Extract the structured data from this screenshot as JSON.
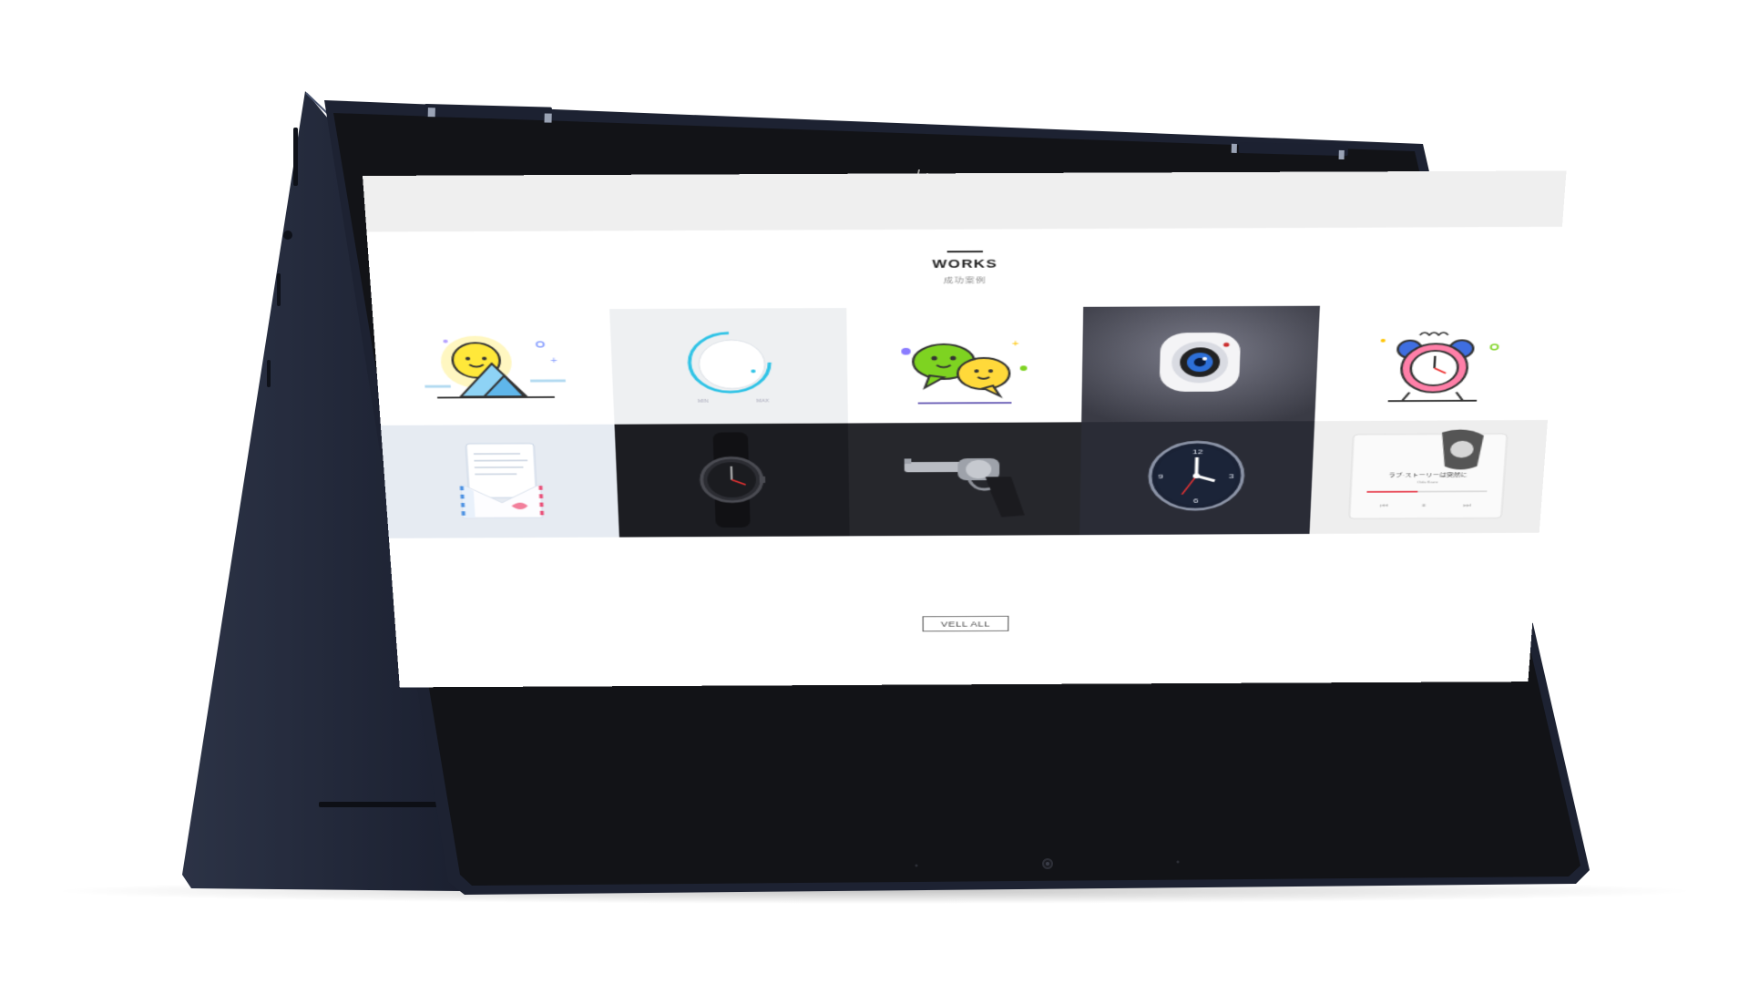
{
  "section": {
    "title": "WORKS",
    "subtitle": "成功案例"
  },
  "cta_label": "VELL ALL",
  "works": [
    {
      "icon": "sun-mountain-icon",
      "bg": "#ffffff"
    },
    {
      "icon": "dial-knob-icon",
      "bg": "#eef0f2"
    },
    {
      "icon": "chat-bubbles-icon",
      "bg": "#ffffff"
    },
    {
      "icon": "camera-app-icon",
      "bg": "#4a4b57"
    },
    {
      "icon": "alarm-clock-icon",
      "bg": "#ffffff"
    },
    {
      "icon": "envelope-letter-icon",
      "bg": "#e6ebf2"
    },
    {
      "icon": "wristwatch-icon",
      "bg": "#1c1d22"
    },
    {
      "icon": "revolver-icon",
      "bg": "#26272c"
    },
    {
      "icon": "wall-clock-icon",
      "bg": "#2a2c36"
    },
    {
      "icon": "music-player-icon",
      "bg": "#eeeeee"
    }
  ],
  "music_player": {
    "song": "ラブ·ストーリーは突然に",
    "artist": "Oda Kazu"
  },
  "clock_numbers": [
    "12",
    "3",
    "6",
    "9"
  ]
}
